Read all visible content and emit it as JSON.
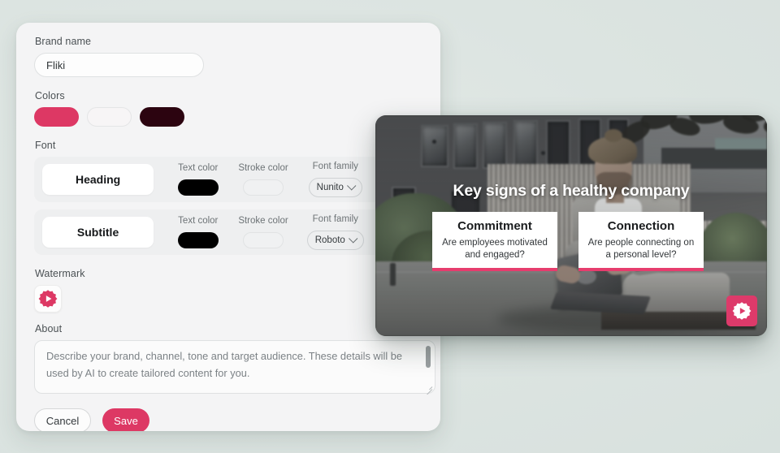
{
  "panel": {
    "brand_name": {
      "label": "Brand name",
      "value": "Fliki"
    },
    "colors": {
      "label": "Colors",
      "swatches": [
        {
          "name": "primary-pink",
          "hex": "#dd3864"
        },
        {
          "name": "light-white",
          "hex": "#f7f5f6"
        },
        {
          "name": "dark-maroon",
          "hex": "#2c0410"
        }
      ]
    },
    "font": {
      "label": "Font",
      "rows": [
        {
          "preview": "Heading",
          "text_color_label": "Text color",
          "text_color_hex": "#000000",
          "stroke_color_label": "Stroke color",
          "stroke_color_hex": "",
          "font_family_label": "Font family",
          "font_family_value": "Nunito"
        },
        {
          "preview": "Subtitle",
          "text_color_label": "Text color",
          "text_color_hex": "#000000",
          "stroke_color_label": "Stroke color",
          "stroke_color_hex": "",
          "font_family_label": "Font family",
          "font_family_value": "Roboto"
        }
      ]
    },
    "watermark": {
      "label": "Watermark",
      "icon": "fliki-play-gear-logo"
    },
    "about": {
      "label": "About",
      "placeholder": "Describe your brand, channel, tone and target audience. These details will be used by AI to create tailored content for you.",
      "value": ""
    },
    "actions": {
      "cancel_label": "Cancel",
      "save_label": "Save"
    }
  },
  "video_preview": {
    "title": "Key signs of a healthy company",
    "cards": [
      {
        "title": "Commitment",
        "body": "Are employees motivated and engaged?"
      },
      {
        "title": "Connection",
        "body": "Are people connecting on a personal level?"
      }
    ],
    "badge_icon": "fliki-play-gear-badge",
    "accent_hex": "#e63c6d"
  }
}
